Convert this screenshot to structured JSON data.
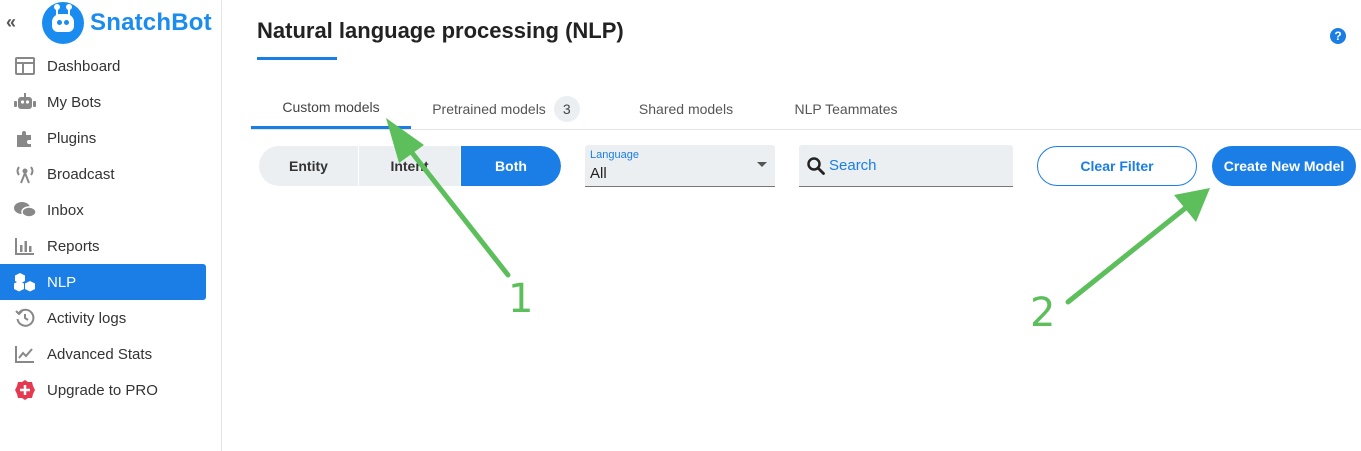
{
  "brand": {
    "name": "SnatchBot"
  },
  "sidebar": {
    "collapse_glyph": "«",
    "items": [
      {
        "label": "Dashboard",
        "icon": "dashboard-icon"
      },
      {
        "label": "My Bots",
        "icon": "robot-icon"
      },
      {
        "label": "Plugins",
        "icon": "puzzle-icon"
      },
      {
        "label": "Broadcast",
        "icon": "broadcast-icon"
      },
      {
        "label": "Inbox",
        "icon": "chat-icon"
      },
      {
        "label": "Reports",
        "icon": "bar-chart-icon"
      },
      {
        "label": "NLP",
        "icon": "cubes-icon",
        "active": true
      },
      {
        "label": "Activity logs",
        "icon": "history-icon"
      },
      {
        "label": "Advanced Stats",
        "icon": "line-chart-icon"
      },
      {
        "label": "Upgrade to PRO",
        "icon": "plus-badge-icon"
      }
    ]
  },
  "main": {
    "title": "Natural language processing (NLP)",
    "help_glyph": "?",
    "tabs": [
      {
        "label": "Custom models",
        "active": true
      },
      {
        "label": "Pretrained models",
        "count": "3"
      },
      {
        "label": "Shared models"
      },
      {
        "label": "NLP Teammates"
      }
    ],
    "filter_segments": [
      {
        "label": "Entity"
      },
      {
        "label": "Intent"
      },
      {
        "label": "Both",
        "selected": true
      }
    ],
    "language": {
      "label": "Language",
      "value": "All"
    },
    "search": {
      "placeholder": "Search"
    },
    "clear_filter_label": "Clear Filter",
    "create_model_label": "Create New Model"
  },
  "annotations": [
    {
      "number": "1"
    },
    {
      "number": "2"
    }
  ],
  "colors": {
    "accent": "#1a7ee6",
    "brand": "#1a8cf0",
    "annotation": "#5cbf5c",
    "upgrade": "#e53950"
  }
}
